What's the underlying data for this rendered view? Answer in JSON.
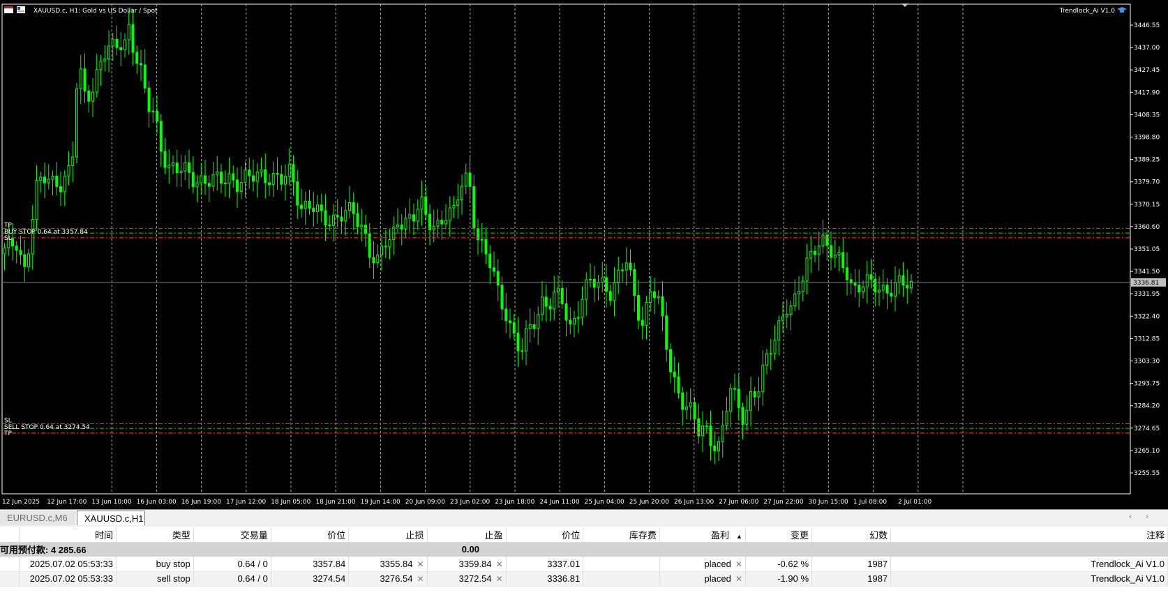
{
  "chart": {
    "title": "XAUUSD.c, H1:  Gold vs US Dollar / Spot",
    "indicator": "Trendlock_Ai V1.0",
    "current_price": "3336.81",
    "buy_order_label": "BUY STOP 0.64 at 3357.84",
    "sell_order_label": "SELL STOP 0.64 at 3274.54",
    "tp_label": "TP",
    "sl_label": "SL",
    "price_levels": [
      "3446.55",
      "3437.00",
      "3427.45",
      "3417.90",
      "3408.35",
      "3398.80",
      "3389.25",
      "3379.70",
      "3370.15",
      "3360.60",
      "3351.05",
      "3341.50",
      "3331.95",
      "3322.40",
      "3312.85",
      "3303.30",
      "3293.75",
      "3284.20",
      "3274.65",
      "3265.10",
      "3255.55"
    ],
    "time_labels": [
      "12 Jun 2025",
      "12 Jun 17:00",
      "13 Jun 10:00",
      "16 Jun 03:00",
      "16 Jun 19:00",
      "17 Jun 12:00",
      "18 Jun 05:00",
      "18 Jun 21:00",
      "19 Jun 14:00",
      "20 Jun 09:00",
      "23 Jun 02:00",
      "23 Jun 18:00",
      "24 Jun 11:00",
      "25 Jun 04:00",
      "25 Jun 20:00",
      "26 Jun 13:00",
      "27 Jun 06:00",
      "27 Jun 22:00",
      "30 Jun 15:00",
      "1 Jul 08:00",
      "2 Jul 01:00"
    ],
    "colors": {
      "candle": "#00ff00",
      "background": "#000000",
      "tp_line": "#00c000",
      "sl_line": "#ff2020",
      "order_line": "#ff2020",
      "bid_line": "#808080"
    }
  },
  "chart_data": {
    "type": "line",
    "title": "XAUUSD.c, H1:  Gold vs US Dollar / Spot",
    "xlabel": "",
    "ylabel": "",
    "ylim": [
      3248.9,
      3453.2
    ],
    "x": [
      0,
      18,
      30,
      45,
      60,
      80,
      95,
      100,
      105,
      115,
      125,
      140,
      155,
      165,
      175,
      180,
      185,
      195,
      205,
      215,
      225,
      235,
      245,
      260,
      275,
      290,
      305,
      320,
      335,
      350,
      365,
      380,
      395,
      410,
      425,
      440,
      455,
      470,
      485,
      500,
      515,
      525,
      535,
      545,
      555,
      565,
      575,
      585,
      595,
      600,
      605,
      615,
      625,
      635,
      645,
      655,
      665,
      670,
      680,
      690,
      700,
      710,
      720,
      730,
      740,
      750,
      760,
      770,
      780,
      790,
      800,
      810,
      820,
      830,
      840,
      850,
      860,
      870,
      880,
      890,
      895,
      905,
      915,
      925,
      935,
      945,
      955,
      965,
      975,
      985,
      995,
      1005,
      1015,
      1025,
      1030,
      1040,
      1050,
      1060,
      1070,
      1080,
      1090,
      1100,
      1110,
      1120,
      1130,
      1140,
      1150,
      1160,
      1170,
      1180,
      1190,
      1200,
      1210,
      1215
    ],
    "series": [
      {
        "values": [
          3349,
          3355,
          3342,
          3375,
          3382,
          3380,
          3383,
          3395,
          3430,
          3418,
          3420,
          3432,
          3436,
          3440,
          3441,
          3450,
          3435,
          3425,
          3412,
          3410,
          3395,
          3385,
          3383,
          3385,
          3382,
          3378,
          3380,
          3384,
          3378,
          3380,
          3385,
          3382,
          3378,
          3385,
          3370,
          3368,
          3364,
          3365,
          3366,
          3365,
          3360,
          3350,
          3345,
          3352,
          3355,
          3365,
          3365,
          3362,
          3370,
          3368,
          3362,
          3364,
          3362,
          3367,
          3364,
          3380,
          3385,
          3368,
          3355,
          3346,
          3342,
          3330,
          3325,
          3313,
          3305,
          3315,
          3322,
          3330,
          3327,
          3330,
          3328,
          3318,
          3325,
          3332,
          3336,
          3335,
          3338,
          3333,
          3340,
          3345,
          3340,
          3328,
          3320,
          3335,
          3330,
          3315,
          3300,
          3292,
          3285,
          3280,
          3272,
          3275,
          3270,
          3267,
          3275,
          3290,
          3285,
          3280,
          3290,
          3290,
          3300,
          3310,
          3320,
          3328,
          3325,
          3333,
          3345,
          3353,
          3357,
          3350,
          3346,
          3345,
          3342,
          3335
        ]
      }
    ]
  },
  "tabs": [
    {
      "label": "EURUSD.c,M6"
    },
    {
      "label": "XAUUSD.c,H1"
    }
  ],
  "table": {
    "headers": [
      "时间",
      "类型",
      "交易量",
      "价位",
      "止损",
      "止盈",
      "价位",
      "库存费",
      "盈利",
      "变更",
      "幻数",
      "注释"
    ],
    "summary": {
      "label": "可用预付款: 4 285.66",
      "profit": "0.00"
    },
    "rows": [
      {
        "time": "2025.07.02 05:53:33",
        "type": "buy stop",
        "volume": "0.64 / 0",
        "price": "3357.84",
        "sl": "3355.84",
        "tp": "3359.84",
        "current": "3337.01",
        "swap": "",
        "profit": "placed",
        "change": "-0.62 %",
        "magic": "1987",
        "comment": "Trendlock_Ai V1.0"
      },
      {
        "time": "2025.07.02 05:53:33",
        "type": "sell stop",
        "volume": "0.64 / 0",
        "price": "3274.54",
        "sl": "3276.54",
        "tp": "3272.54",
        "current": "3336.81",
        "swap": "",
        "profit": "placed",
        "change": "-1.90 %",
        "magic": "1987",
        "comment": "Trendlock_Ai V1.0"
      }
    ]
  }
}
